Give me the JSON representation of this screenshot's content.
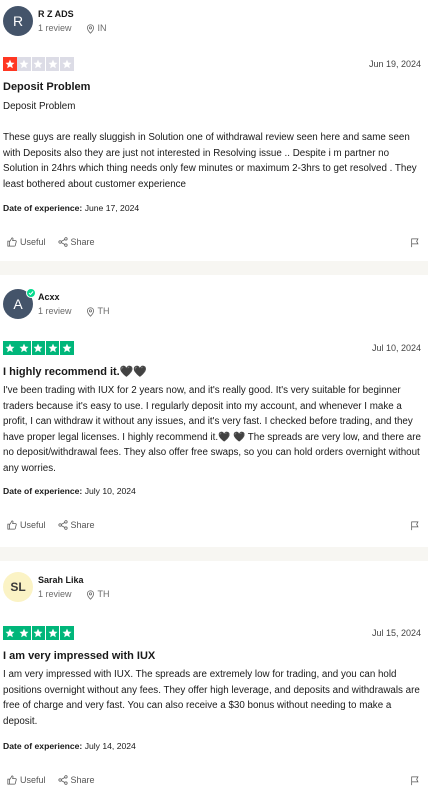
{
  "colors": {
    "star_red": "#ff3722",
    "star_green": "#00b67a",
    "star_empty": "#dcdce6",
    "separator": "#f7f6f2"
  },
  "reviews": [
    {
      "avatar_initials": "R",
      "user_name": "R Z ADS",
      "review_count": "1 review",
      "country": "IN",
      "rating": 1,
      "date": "Jun 19, 2024",
      "title": "Deposit Problem",
      "subtitle": "Deposit Problem",
      "body": "These guys are really sluggish in Solution one of withdrawal review seen here and same seen with Deposits also they are just not interested in Resolving issue .. Despite i m partner no Solution in 24hrs which thing needs only few minutes or maximum 2-3hrs to get resolved . They least bothered about customer experience",
      "doe_label": "Date of experience:",
      "doe_value": "June 17, 2024",
      "useful_label": "Useful",
      "share_label": "Share"
    },
    {
      "avatar_initials": "A",
      "user_name": "Acxx",
      "review_count": "1 review",
      "country": "TH",
      "rating": 5,
      "date": "Jul 10, 2024",
      "title": "I highly recommend it.🖤🖤",
      "subtitle": "",
      "body": "I've been trading with IUX for 2 years now, and it's really good. It's very suitable for beginner traders because it's easy to use. I regularly deposit into my account, and whenever I make a profit, I can withdraw it without any issues, and it's very fast. I checked before trading, and they have proper legal licenses. I highly recommend it.🖤 🖤 The spreads are very low, and there are no deposit/withdrawal fees. They also offer free swaps, so you can hold orders overnight without any worries.",
      "doe_label": "Date of experience:",
      "doe_value": "July 10, 2024",
      "useful_label": "Useful",
      "share_label": "Share"
    },
    {
      "avatar_initials": "SL",
      "user_name": "Sarah Lika",
      "review_count": "1 review",
      "country": "TH",
      "rating": 5,
      "date": "Jul 15, 2024",
      "title": "I am very impressed with IUX",
      "subtitle": "",
      "body": "I am very impressed with IUX. The spreads are extremely low for trading, and you can hold positions overnight without any fees. They offer high leverage, and deposits and withdrawals are free of charge and very fast. You can also receive a $30 bonus without needing to make a deposit.",
      "doe_label": "Date of experience:",
      "doe_value": "July 14, 2024",
      "useful_label": "Useful",
      "share_label": "Share"
    }
  ]
}
